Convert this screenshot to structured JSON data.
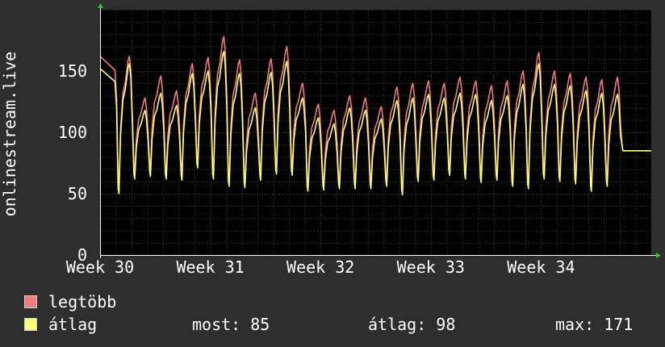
{
  "chart_data": {
    "type": "line",
    "ylabel": "onlinestream.live",
    "ylim": [
      0,
      200
    ],
    "yticks": [
      0,
      50,
      100,
      150
    ],
    "xlim": [
      0,
      35
    ],
    "xticks": [
      {
        "label": "Week 30",
        "value": 0
      },
      {
        "label": "Week 31",
        "value": 7
      },
      {
        "label": "Week 32",
        "value": 14
      },
      {
        "label": "Week 33",
        "value": 21
      },
      {
        "label": "Week 34",
        "value": 28
      }
    ],
    "x_unit": "days from start of Week 30",
    "grid": true,
    "background": "#000000",
    "daily_peaks": [
      {
        "legtobb": 162,
        "atlag": 152
      },
      {
        "legtobb": 162,
        "atlag": 156
      },
      {
        "legtobb": 128,
        "atlag": 118
      },
      {
        "legtobb": 146,
        "atlag": 132
      },
      {
        "legtobb": 134,
        "atlag": 122
      },
      {
        "legtobb": 156,
        "atlag": 148
      },
      {
        "legtobb": 161,
        "atlag": 150
      },
      {
        "legtobb": 178,
        "atlag": 166
      },
      {
        "legtobb": 159,
        "atlag": 148
      },
      {
        "legtobb": 132,
        "atlag": 120
      },
      {
        "legtobb": 160,
        "atlag": 149
      },
      {
        "legtobb": 170,
        "atlag": 158
      },
      {
        "legtobb": 140,
        "atlag": 128
      },
      {
        "legtobb": 123,
        "atlag": 112
      },
      {
        "legtobb": 118,
        "atlag": 107
      },
      {
        "legtobb": 130,
        "atlag": 120
      },
      {
        "legtobb": 128,
        "atlag": 118
      },
      {
        "legtobb": 121,
        "atlag": 111
      },
      {
        "legtobb": 137,
        "atlag": 126
      },
      {
        "legtobb": 140,
        "atlag": 128
      },
      {
        "legtobb": 142,
        "atlag": 131
      },
      {
        "legtobb": 140,
        "atlag": 128
      },
      {
        "legtobb": 145,
        "atlag": 132
      },
      {
        "legtobb": 142,
        "atlag": 131
      },
      {
        "legtobb": 138,
        "atlag": 126
      },
      {
        "legtobb": 142,
        "atlag": 130
      },
      {
        "legtobb": 150,
        "atlag": 139
      },
      {
        "legtobb": 165,
        "atlag": 156
      },
      {
        "legtobb": 150,
        "atlag": 139
      },
      {
        "legtobb": 148,
        "atlag": 138
      },
      {
        "legtobb": 145,
        "atlag": 134
      },
      {
        "legtobb": 143,
        "atlag": 132
      },
      {
        "legtobb": 145,
        "atlag": 131
      }
    ],
    "daily_troughs": [
      {
        "legtobb": 84,
        "atlag": 80
      },
      {
        "legtobb": 55,
        "atlag": 50
      },
      {
        "legtobb": 66,
        "atlag": 62
      },
      {
        "legtobb": 68,
        "atlag": 64
      },
      {
        "legtobb": 66,
        "atlag": 62
      },
      {
        "legtobb": 65,
        "atlag": 61
      },
      {
        "legtobb": 75,
        "atlag": 71
      },
      {
        "legtobb": 66,
        "atlag": 62
      },
      {
        "legtobb": 60,
        "atlag": 56
      },
      {
        "legtobb": 59,
        "atlag": 55
      },
      {
        "legtobb": 65,
        "atlag": 61
      },
      {
        "legtobb": 70,
        "atlag": 66
      },
      {
        "legtobb": 69,
        "atlag": 65
      },
      {
        "legtobb": 56,
        "atlag": 52
      },
      {
        "legtobb": 57,
        "atlag": 53
      },
      {
        "legtobb": 58,
        "atlag": 54
      },
      {
        "legtobb": 58,
        "atlag": 54
      },
      {
        "legtobb": 58,
        "atlag": 54
      },
      {
        "legtobb": 60,
        "atlag": 56
      },
      {
        "legtobb": 53,
        "atlag": 49
      },
      {
        "legtobb": 64,
        "atlag": 60
      },
      {
        "legtobb": 65,
        "atlag": 61
      },
      {
        "legtobb": 69,
        "atlag": 65
      },
      {
        "legtobb": 66,
        "atlag": 62
      },
      {
        "legtobb": 63,
        "atlag": 59
      },
      {
        "legtobb": 65,
        "atlag": 61
      },
      {
        "legtobb": 60,
        "atlag": 56
      },
      {
        "legtobb": 58,
        "atlag": 54
      },
      {
        "legtobb": 66,
        "atlag": 62
      },
      {
        "legtobb": 64,
        "atlag": 60
      },
      {
        "legtobb": 62,
        "atlag": 58
      },
      {
        "legtobb": 56,
        "atlag": 52
      },
      {
        "legtobb": 60,
        "atlag": 56
      },
      {
        "legtobb": 85,
        "atlag": 85
      }
    ],
    "series": [
      {
        "name": "legtöbb",
        "key": "legtobb",
        "color": "#f07c7c"
      },
      {
        "name": "átlag",
        "key": "atlag",
        "color": "#fcfc78"
      }
    ]
  },
  "legend": {
    "items": [
      {
        "label": "legtöbb",
        "color": "#f07c7c"
      },
      {
        "label": "átlag",
        "color": "#fcfc78"
      }
    ],
    "stats": {
      "now": "most: 85",
      "avg": "átlag: 98",
      "max": "max: 171"
    }
  }
}
